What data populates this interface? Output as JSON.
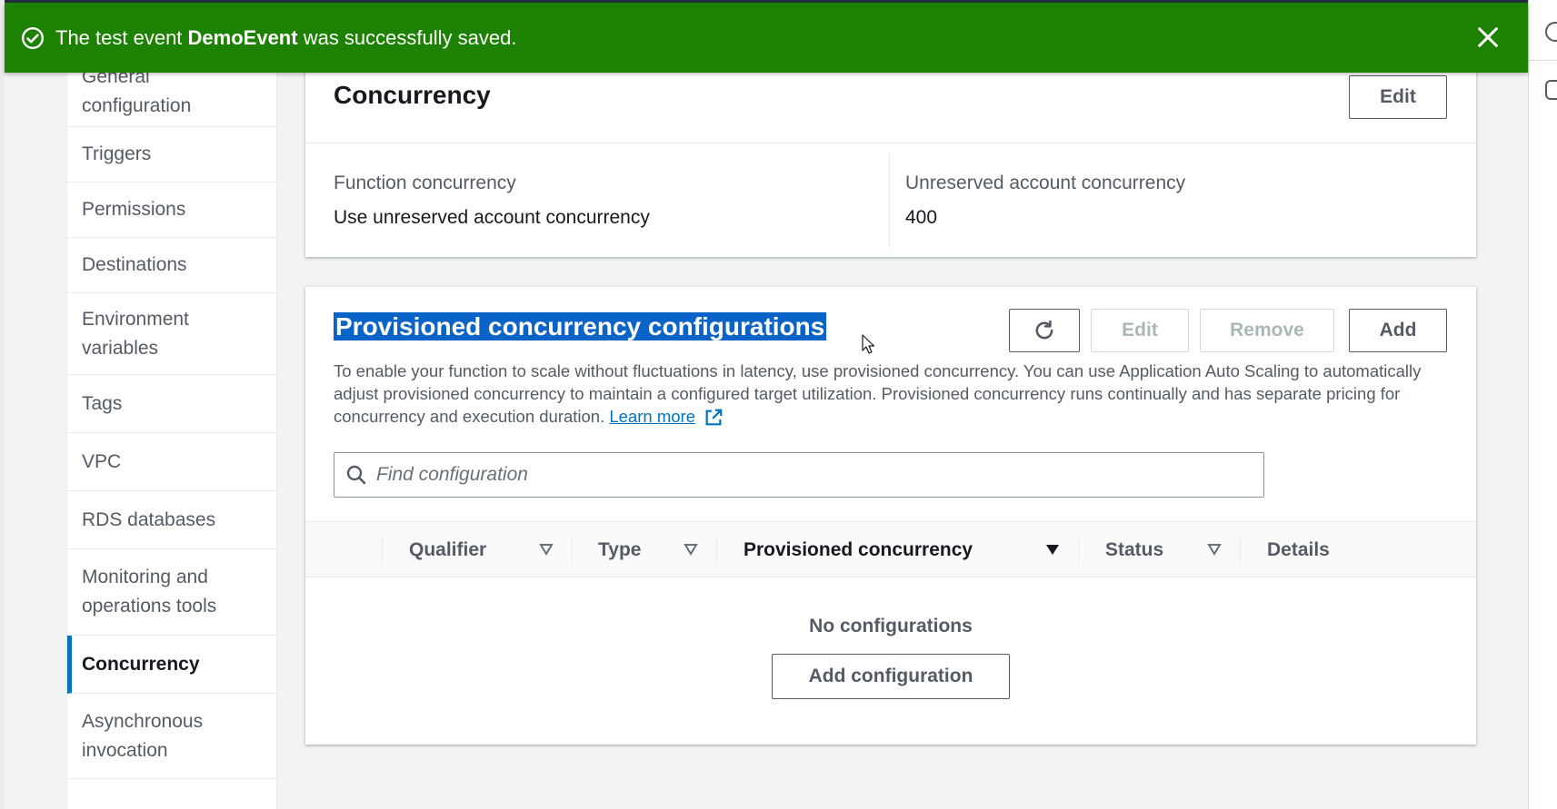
{
  "flash": {
    "prefix": "The test event ",
    "event_name": "DemoEvent",
    "suffix": " was successfully saved."
  },
  "sidebar": {
    "items": [
      {
        "label": "General configuration"
      },
      {
        "label": "Triggers"
      },
      {
        "label": "Permissions"
      },
      {
        "label": "Destinations"
      },
      {
        "label": "Environment variables"
      },
      {
        "label": "Tags"
      },
      {
        "label": "VPC"
      },
      {
        "label": "RDS databases"
      },
      {
        "label": "Monitoring and operations tools"
      },
      {
        "label": "Concurrency",
        "active": true
      },
      {
        "label": "Asynchronous invocation"
      }
    ]
  },
  "concurrency": {
    "title": "Concurrency",
    "edit_label": "Edit",
    "function_concurrency_label": "Function concurrency",
    "function_concurrency_value": "Use unreserved account concurrency",
    "unreserved_label": "Unreserved account concurrency",
    "unreserved_value": "400"
  },
  "provisioned": {
    "title": "Provisioned concurrency configurations",
    "edit_label": "Edit",
    "remove_label": "Remove",
    "add_label": "Add",
    "description": "To enable your function to scale without fluctuations in latency, use provisioned concurrency. You can use Application Auto Scaling to automatically adjust provisioned concurrency to maintain a configured target utilization. Provisioned concurrency runs continually and has separate pricing for concurrency and execution duration.",
    "learn_more": "Learn more",
    "search_placeholder": "Find configuration",
    "columns": [
      "Qualifier",
      "Type",
      "Provisioned concurrency",
      "Status",
      "Details"
    ],
    "empty_text": "No configurations",
    "add_config_label": "Add configuration"
  },
  "colors": {
    "success": "#1d8102",
    "accent": "#0073bb",
    "selection": "#0a63c7"
  }
}
